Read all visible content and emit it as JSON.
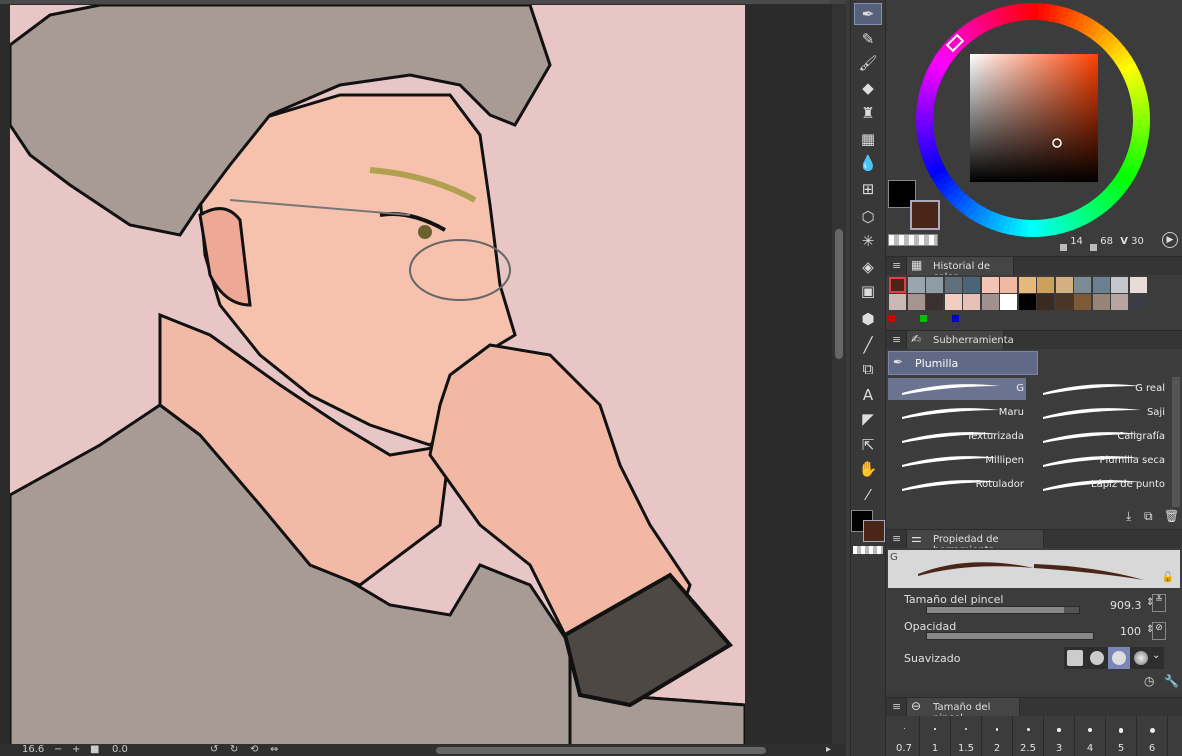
{
  "canvas": {
    "zoom": "16.6",
    "rotation": "0.0"
  },
  "toolbar": {
    "tools": [
      "pen-icon",
      "pencil-icon",
      "brush-icon",
      "eraser-icon",
      "decoration-icon",
      "airbrush-icon",
      "blend-icon",
      "figure-icon",
      "lasso-icon",
      "magic-wand-icon",
      "fill-icon",
      "gradient-icon",
      "3d-object-icon",
      "line-icon",
      "frame-icon",
      "text-icon",
      "balloon-icon",
      "ruler-icon",
      "hand-icon",
      "eyedropper-icon"
    ]
  },
  "colors": {
    "main": "#000000",
    "sub": "#4a2618",
    "wheel_hue": "#ff4000",
    "accent": "#56607a"
  },
  "color_wheel": {
    "h": "14",
    "s": "68",
    "v": "30",
    "h_label": "H",
    "s_label": "S",
    "v_label": "V"
  },
  "color_history": {
    "title": "Historial de color",
    "row1": [
      "#4a2618",
      "#9aa6ae",
      "#8e9ca6",
      "#5f6f7c",
      "#4c6478",
      "#f3c3b3",
      "#f0b8a0",
      "#e6b87a",
      "#caa05a",
      "#d4b080",
      "#7c8c94",
      "#6a8090",
      "#c4c8cc",
      "#e8dcd8"
    ],
    "row2": [
      "#c9b8b4",
      "#a59490",
      "#3b3030",
      "#f5ccc0",
      "#e8c0b8",
      "#a09090",
      "#ffffff",
      "#000000",
      "#3a2a22",
      "#4a3628",
      "#7c5a3a",
      "#968478",
      "#b8a4a0",
      "#3a3e44"
    ],
    "rgb": [
      "#d00000",
      "#00c000",
      "#0000e0"
    ]
  },
  "subtool": {
    "title": "Subherramienta",
    "group": "Plumilla",
    "brushes": [
      {
        "left": "G",
        "right": "G real"
      },
      {
        "left": "Maru",
        "right": "Saji"
      },
      {
        "left": "Texturizada",
        "right": "Caligrafía"
      },
      {
        "left": "Millipen",
        "right": "Plumilla seca"
      },
      {
        "left": "Rotulador",
        "right": "Lápiz de punto"
      }
    ]
  },
  "tool_property": {
    "title": "Propiedad de herramienta",
    "preview_label": "G",
    "brush_size_label": "Tamaño del pincel",
    "brush_size_value": "909.3",
    "brush_size_fill": 0.9,
    "opacity_label": "Opacidad",
    "opacity_value": "100",
    "opacity_fill": 1.0,
    "stabilization_label": "Suavizado"
  },
  "brush_size": {
    "title": "Tamaño del pincel",
    "sizes": [
      "0.7",
      "1",
      "1.5",
      "2",
      "2.5",
      "3",
      "4",
      "5",
      "6"
    ]
  }
}
